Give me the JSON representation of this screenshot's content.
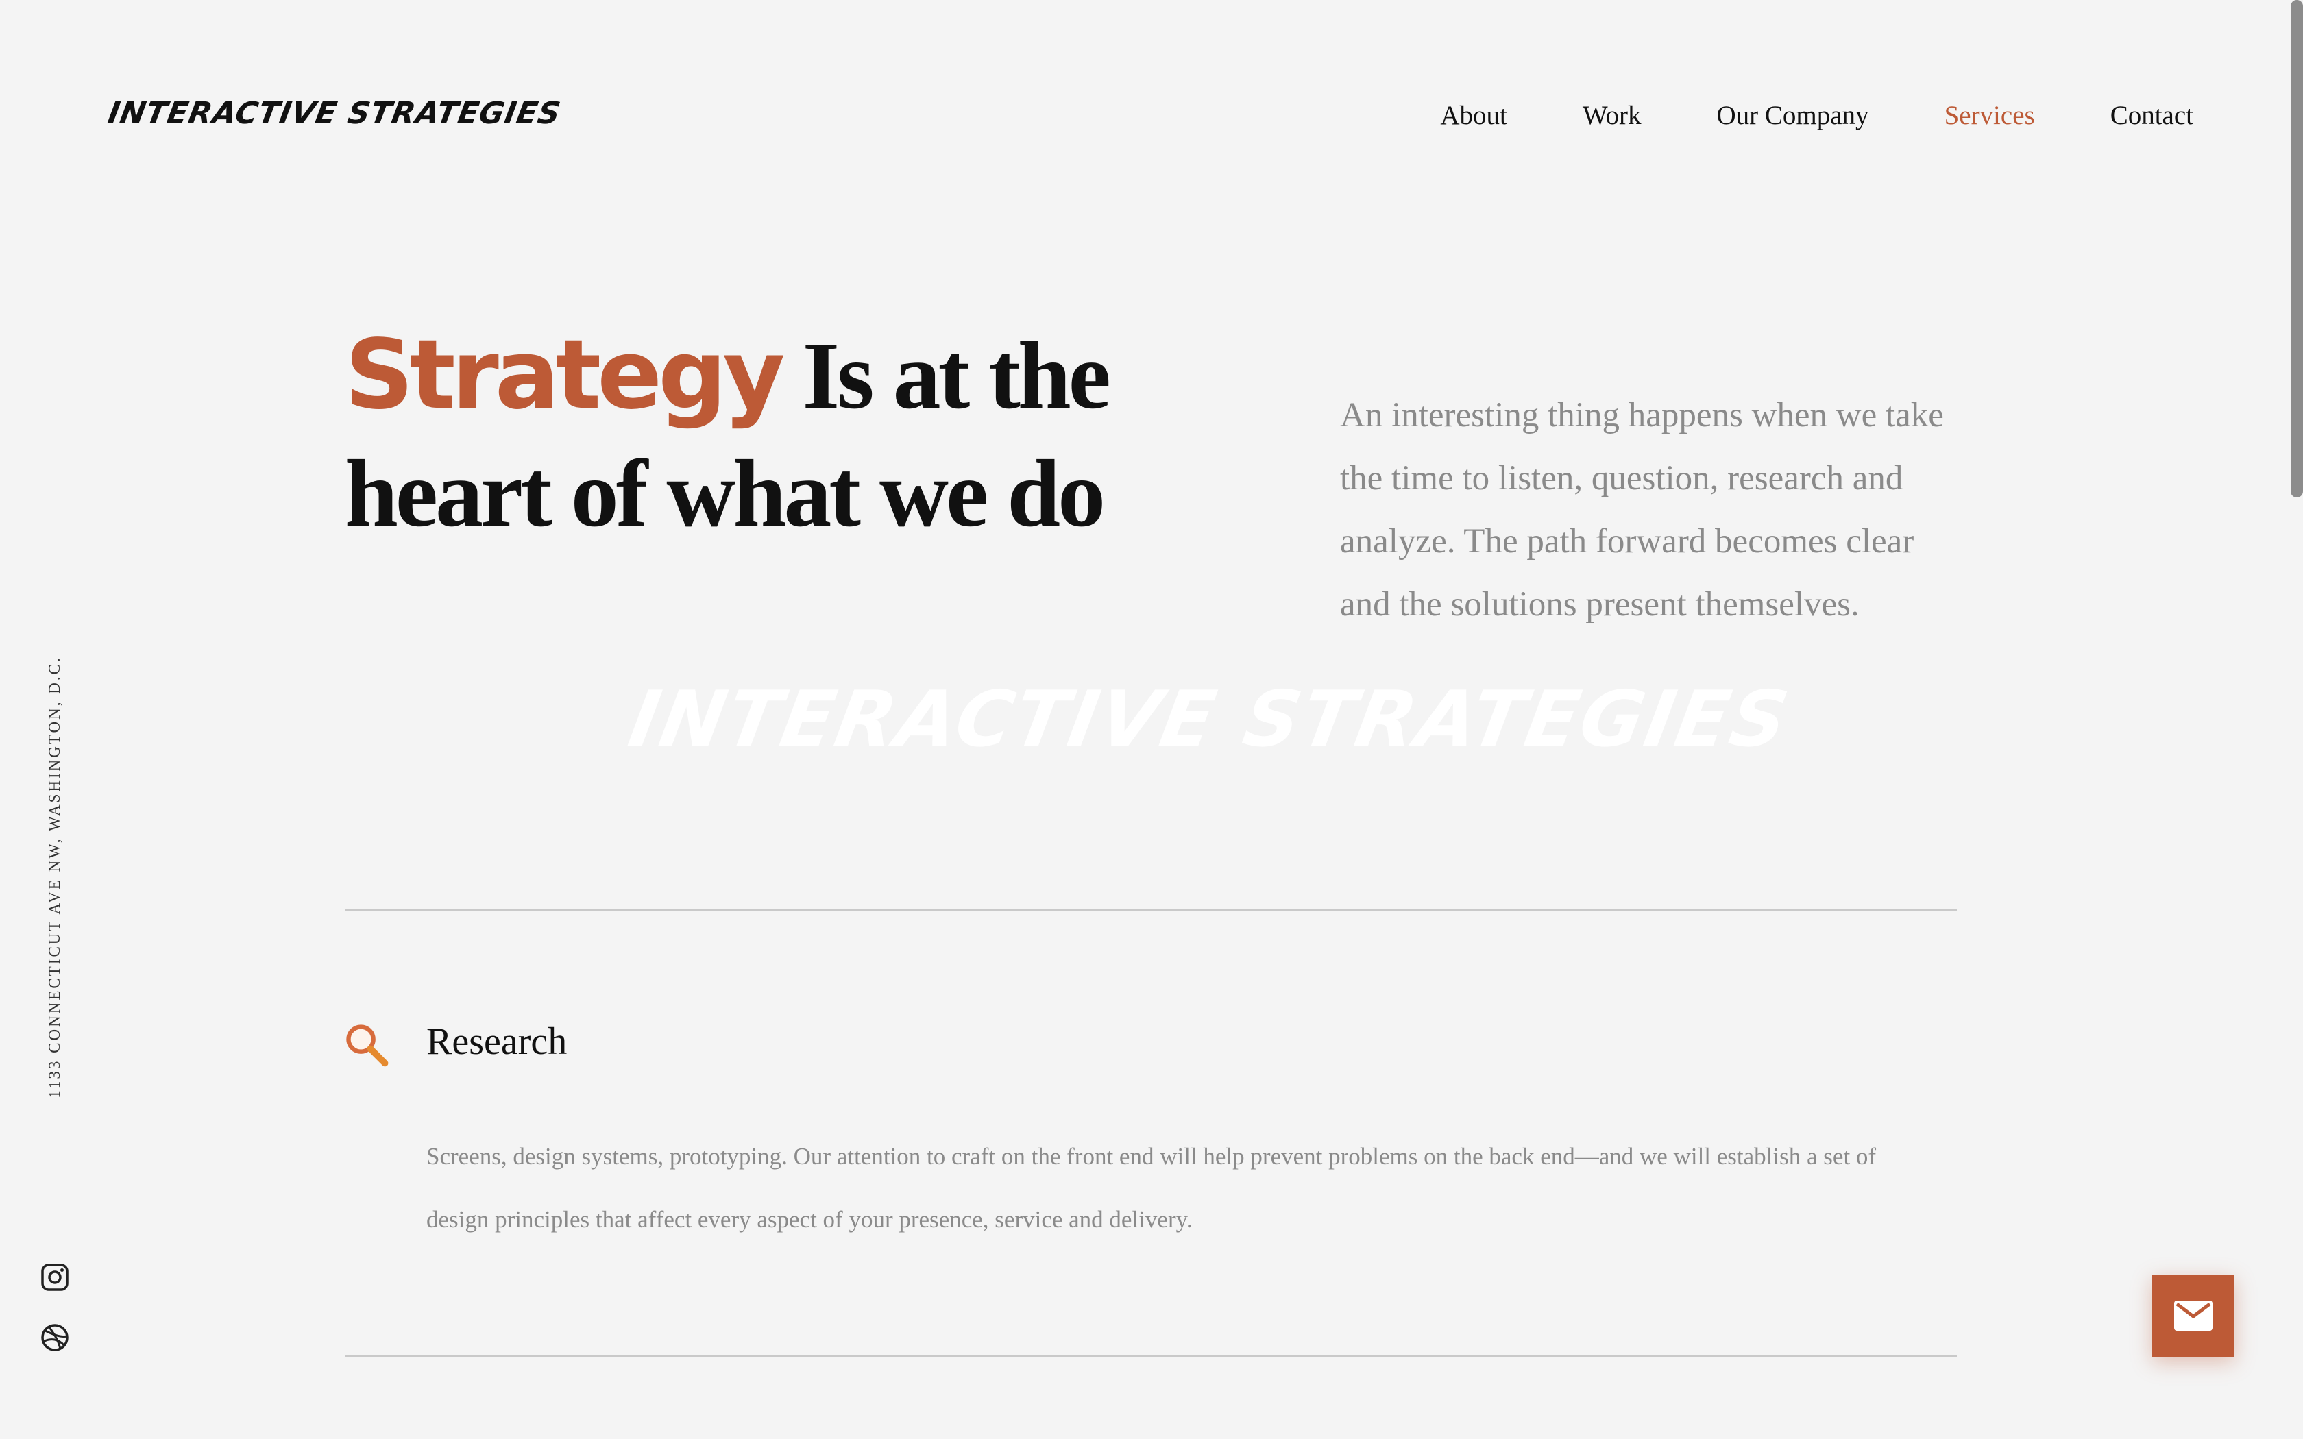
{
  "brand": {
    "logo": "INTERACTIVE STRATEGIES",
    "watermark": "INTERACTIVE STRATEGIES",
    "accent_color": "#bd5a36"
  },
  "nav": {
    "items": [
      {
        "label": "About"
      },
      {
        "label": "Work"
      },
      {
        "label": "Our Company"
      },
      {
        "label": "Services",
        "active": true
      },
      {
        "label": "Contact"
      }
    ]
  },
  "hero": {
    "title_accent": "Strategy",
    "title_rest": " Is at the heart of what we do",
    "text": "An interesting thing happens when we take the time to listen, question, research and analyze. The path forward becomes clear and the solutions present themselves."
  },
  "service": {
    "icon": "search-icon",
    "title": "Research",
    "description": "Screens, design systems, prototyping. Our attention to craft on the front end will help prevent problems on the back end—and we will establish a set of design principles that affect every aspect of your presence, service and delivery."
  },
  "sidebar": {
    "address": "1133 CONNECTICUT AVE NW, WASHINGTON, D.C.",
    "social": [
      "instagram-icon",
      "dribbble-icon"
    ]
  },
  "floating": {
    "icon": "mail-icon"
  }
}
